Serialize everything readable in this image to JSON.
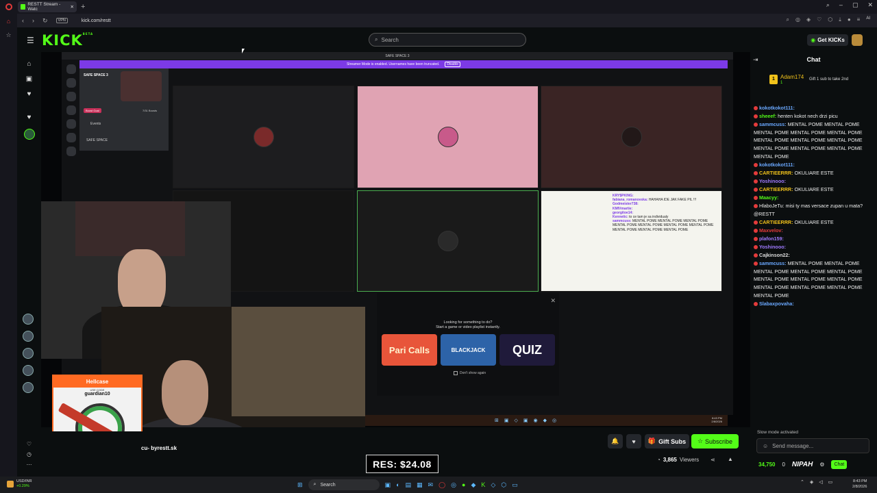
{
  "browser": {
    "tab_title": "RESTT Stream - Watc",
    "url": "kick.com/restt",
    "vpn_label": "VPN",
    "ai_label": "AI"
  },
  "header": {
    "logo": "KICK",
    "logo_beta": "BETA",
    "search_placeholder": "Search",
    "get_kicks": "Get KICKs"
  },
  "discord": {
    "window_title": "SAFE SPACE 3",
    "streamer_mode_text": "Streamer Mode is enabled. Usernames have been truncated.",
    "disable_label": "Disable",
    "server_name": "SAFE SPACE 3",
    "boost_goal": "Boost Goal",
    "boost_count": "7/31 Boosts",
    "events_label": "Events",
    "channel_label": "SAFE SPACE",
    "popup_line1": "Looking for something to do?",
    "popup_line2": "Start a game or video playlist instantly.",
    "games": [
      "Pari Calls",
      "BLACKJACK",
      "QUIZ"
    ],
    "dont_show": "Don't show again",
    "shot_chat": [
      {
        "user": "KRY$PKING:",
        "text": ""
      },
      {
        "user": "fabiana_romanovska:",
        "text": "HAHAHA IDE JAK FAKE PIL !!!"
      },
      {
        "user": "Godmeister738:",
        "text": ""
      },
      {
        "user": "KMIVmartie:",
        "text": ""
      },
      {
        "user": "georgitoe14:",
        "text": ""
      },
      {
        "user": "Kennetic:",
        "text": "to ce tam je sa individualy"
      },
      {
        "user": "sammcuss:",
        "text": "MENTAL POME MENTAL POME MENTAL POME MENTAL POME MENTAL POME MENTAL POME MENTAL POME MENTAL POME MENTAL POME MENTAL POME"
      }
    ]
  },
  "sponsor": {
    "brand": "Hellcase",
    "use_code": "USE CODE",
    "code": "guardian10"
  },
  "stream": {
    "streamer_name": "cu- byrestt.sk",
    "res_text": "RES: $24.08",
    "gift_subs": "Gift Subs",
    "subscribe": "Subscribe",
    "viewers": "3,865",
    "viewers_label": "Viewers"
  },
  "chat": {
    "title": "Chat",
    "pinned_rank": "1",
    "pinned_user": "Adam174",
    "pinned_count": "1",
    "pinned_text": "Gift 1 sub to take 2nd",
    "messages": [
      {
        "user": "kokotkokot111:",
        "color": "#6aa8ff",
        "text": ""
      },
      {
        "user": "sheeef:",
        "color": "#53fc18",
        "text": "henten kokot nech drzi picu"
      },
      {
        "user": "sammcuss:",
        "color": "#6aa8ff",
        "text": "MENTAL POME MENTAL POME MENTAL POME MENTAL POME MENTAL POME MENTAL POME MENTAL POME MENTAL POME MENTAL POME MENTAL POME MENTAL POME MENTAL POME"
      },
      {
        "user": "kokotkokot111:",
        "color": "#6aa8ff",
        "text": ""
      },
      {
        "user": "CARTIEERRR:",
        "color": "#f1c21b",
        "text": "OKULIARE ESTE"
      },
      {
        "user": "Yoshinooo:",
        "color": "#9f7aff",
        "text": ""
      },
      {
        "user": "CARTIEERRR:",
        "color": "#f1c21b",
        "text": "OKULIARE ESTE"
      },
      {
        "user": "Maacyy:",
        "color": "#53fc18",
        "text": ""
      },
      {
        "user": "",
        "color": "#eee",
        "text": "HlaboJeTu: misi ty mas versace zupan u mata? @RESTT"
      },
      {
        "user": "CARTIEERRR:",
        "color": "#f1c21b",
        "text": "OKULIARE ESTE"
      },
      {
        "user": "Maxvelov:",
        "color": "#e43b3b",
        "text": ""
      },
      {
        "user": "plafon159:",
        "color": "#9f7aff",
        "text": ""
      },
      {
        "user": "Yoshinooo:",
        "color": "#9f7aff",
        "text": ""
      },
      {
        "user": "Cajkinson22:",
        "color": "#ddd",
        "text": ""
      },
      {
        "user": "sammcuss:",
        "color": "#6aa8ff",
        "text": "MENTAL POME MENTAL POME MENTAL POME MENTAL POME MENTAL POME MENTAL POME MENTAL POME MENTAL POME MENTAL POME MENTAL POME MENTAL POME MENTAL POME"
      },
      {
        "user": "Slabaxpovaha:",
        "color": "#6aa8ff",
        "text": ""
      }
    ],
    "slow_mode": "Slow mode activated",
    "send_placeholder": "Send message...",
    "points": "34,750",
    "zero": "0",
    "nipah": "NIPAH",
    "chat_btn": "Chat"
  },
  "taskbar": {
    "ticker_pair": "USD/INR",
    "ticker_change": "+0.29%",
    "search": "Search",
    "time": "8:43 PM",
    "date": "2/8/2026"
  },
  "colors": {
    "kick_green": "#53fc18",
    "discord_purple": "#7c3ae6",
    "hellcase_orange": "#ff6a22"
  }
}
